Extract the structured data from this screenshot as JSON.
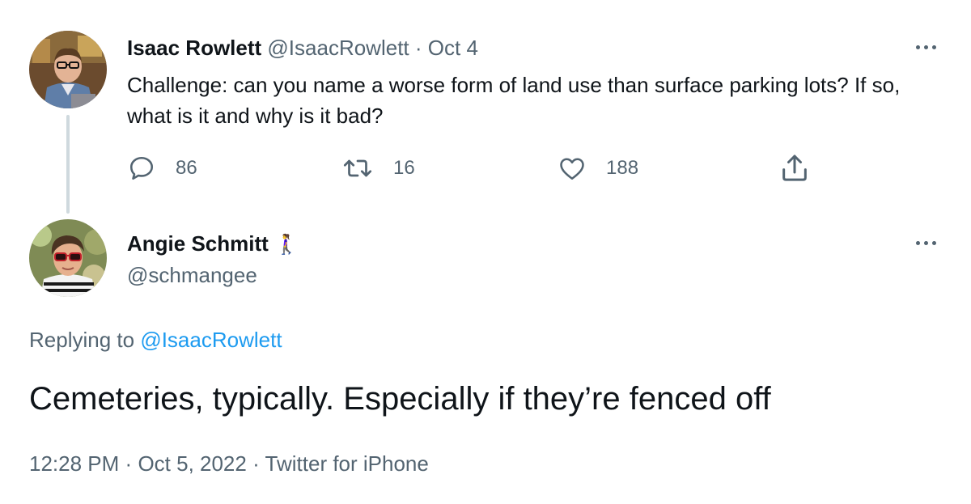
{
  "original_tweet": {
    "name": "Isaac Rowlett",
    "handle": "@IsaacRowlett",
    "separator": "·",
    "date": "Oct 4",
    "text": "Challenge: can you name a worse form of land use than surface parking lots? If so, what is it and why is it bad?",
    "actions": {
      "reply_icon": "reply-icon",
      "reply_count": "86",
      "retweet_icon": "retweet-icon",
      "retweet_count": "16",
      "like_icon": "heart-icon",
      "like_count": "188",
      "share_icon": "share-icon"
    }
  },
  "reply_tweet": {
    "name": "Angie Schmitt",
    "name_emoji": "🚶‍♀️",
    "handle": "@schmangee",
    "replying_prefix": "Replying to",
    "replying_to": "@IsaacRowlett",
    "text": "Cemeteries, typically. Especially if they’re fenced off",
    "time": "12:28 PM",
    "separator": "·",
    "date": "Oct 5, 2022",
    "source": "Twitter for iPhone"
  },
  "colors": {
    "text_primary": "#0f1419",
    "text_secondary": "#536471",
    "link": "#1d9bf0",
    "thread_line": "#cfd9de"
  }
}
